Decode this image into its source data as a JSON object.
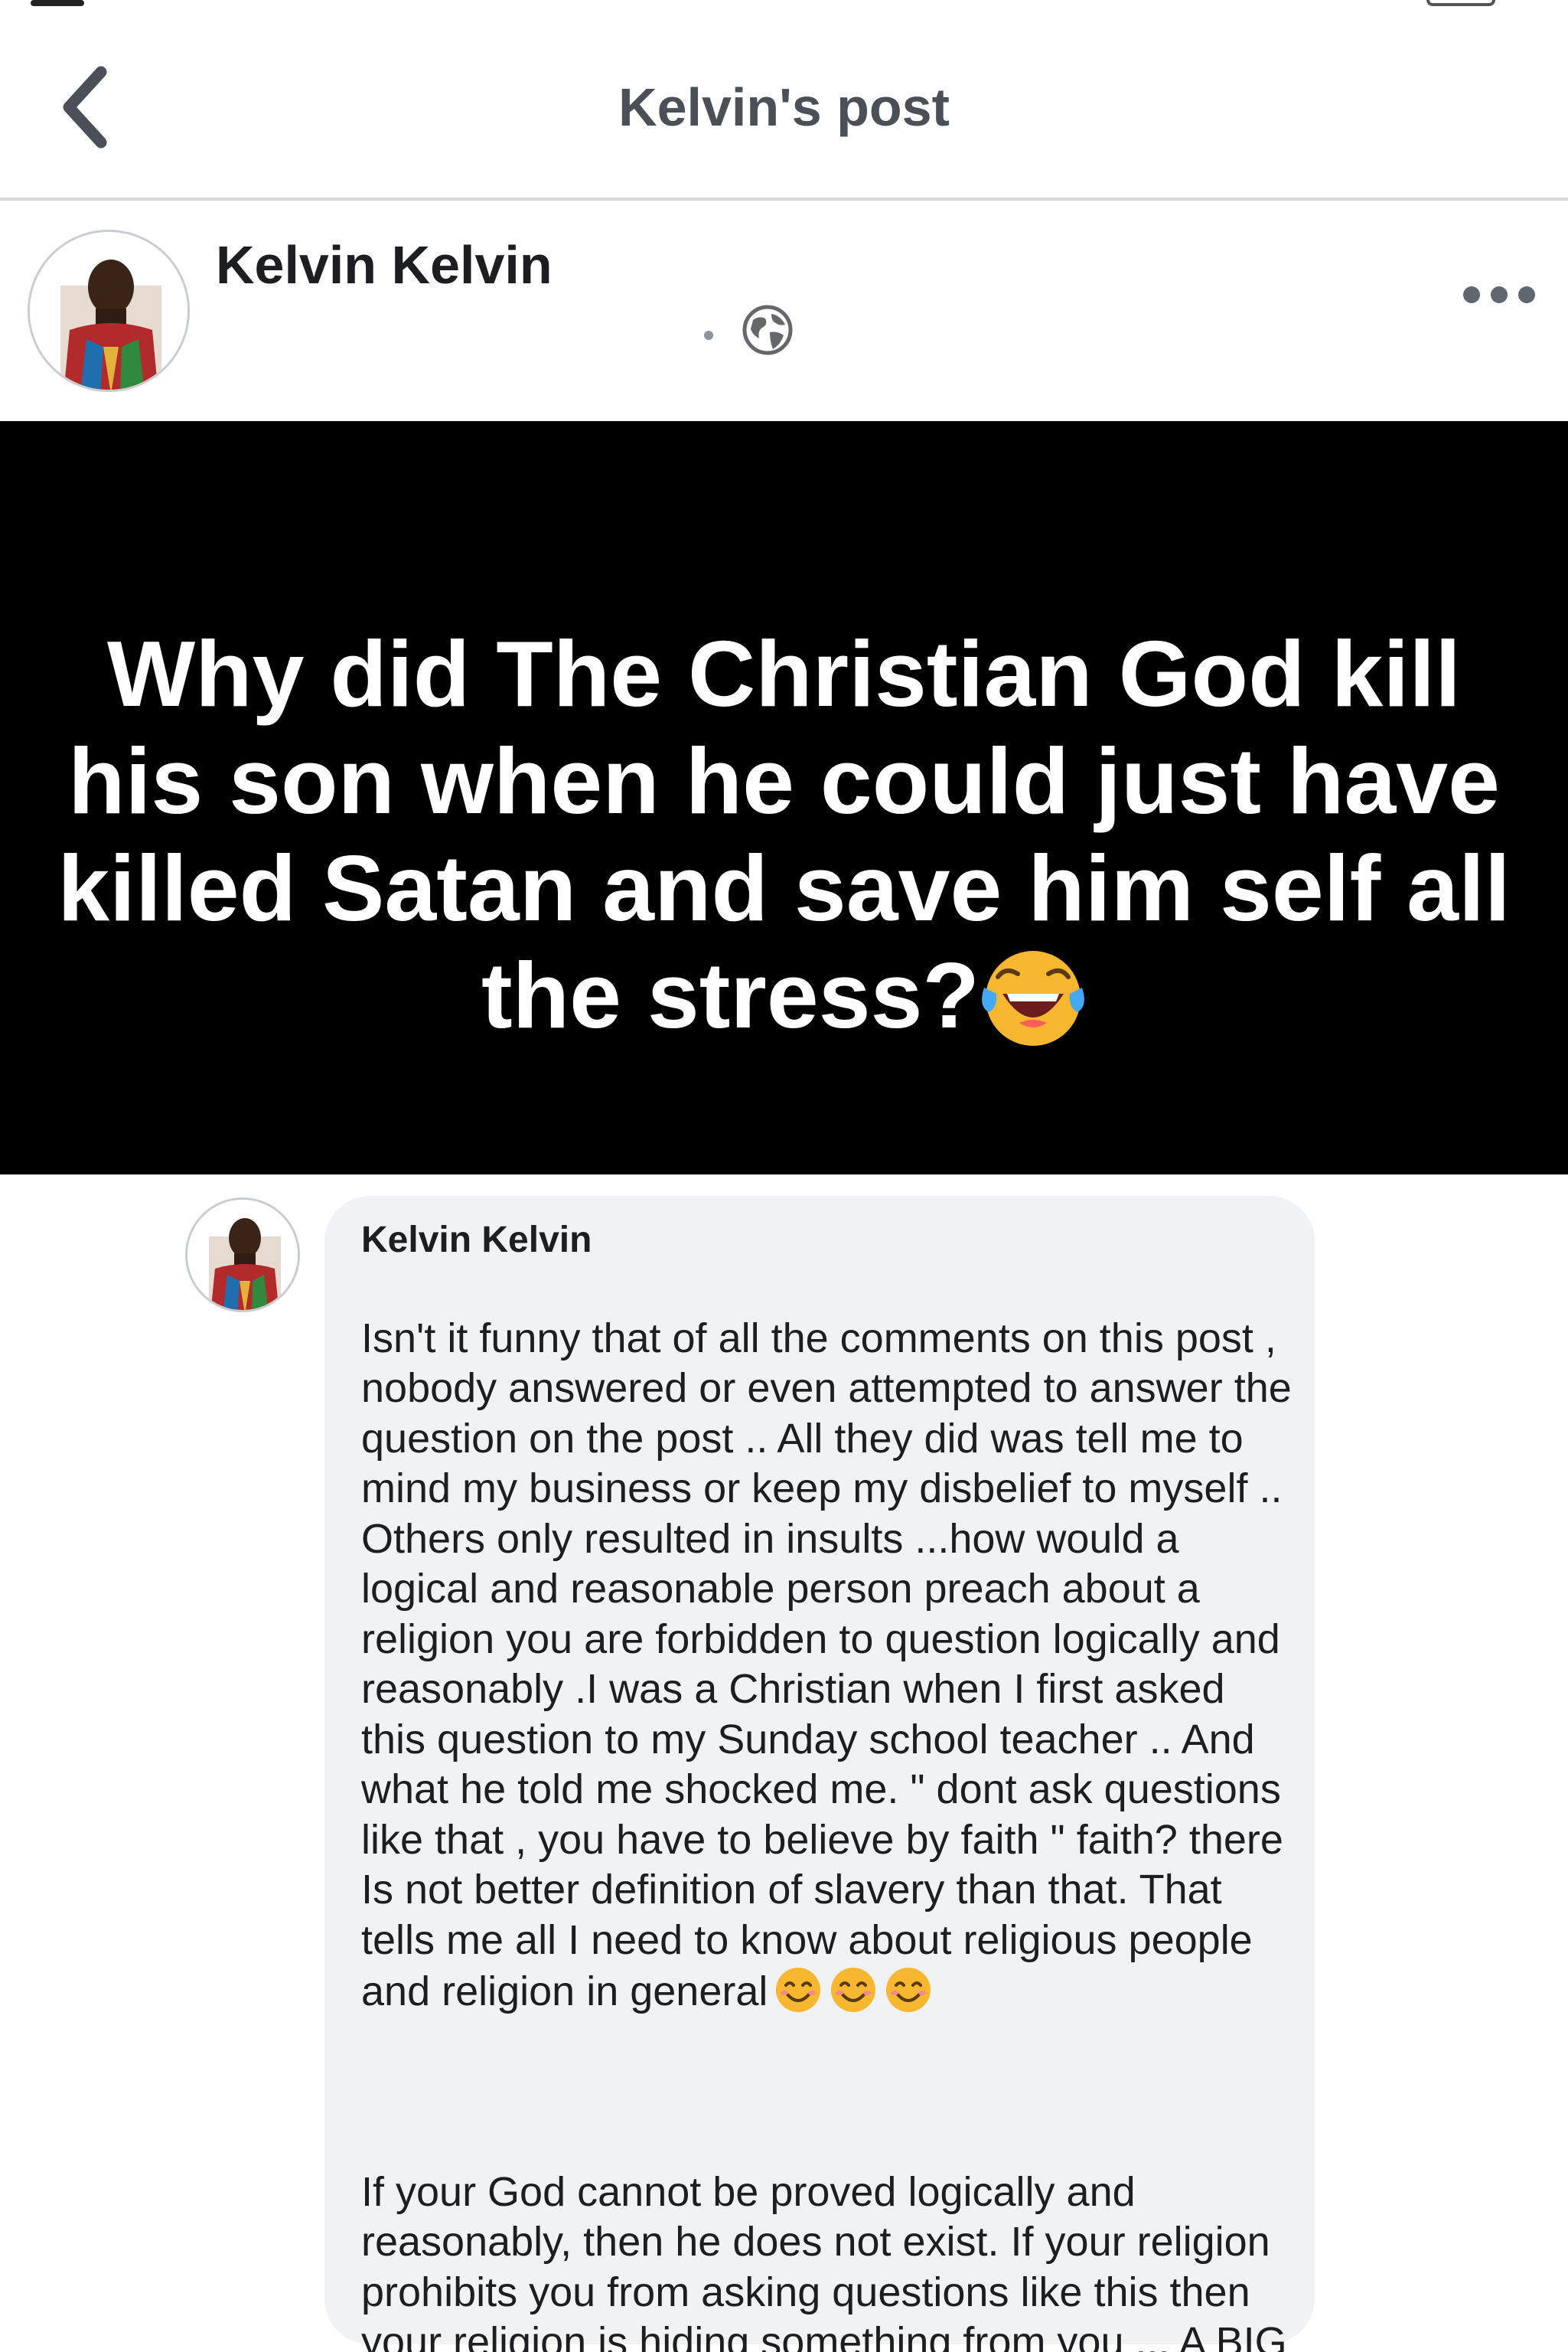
{
  "header": {
    "title": "Kelvin's post",
    "back_icon": "chevron-left-icon"
  },
  "post": {
    "author": "Kelvin Kelvin",
    "separator": "·",
    "privacy_icon": "globe-icon",
    "more_icon": "more-dots-icon",
    "image_text": "Why did The Christian  God kill his son when he could just have killed Satan and save him self all the stress?",
    "image_emoji": "face-with-tears-of-joy-emoji",
    "image_background": "#000000"
  },
  "comment": {
    "author": "Kelvin Kelvin",
    "paragraph_1": "Isn't it funny that of all the comments on this post , nobody answered or even attempted to answer the question on the post .. All they did was tell me to mind my business or keep my disbelief to myself .. Others only resulted in insults ...how would a logical and reasonable person preach about a religion you are forbidden to question logically and reasonably .I was a Christian when I first asked this question to my Sunday school teacher .. And what he told me shocked me. \" dont ask questions like that , you have to believe by faith \" faith?  there Is not better definition of slavery than that.  That tells me all I need to know about religious people and religion in general",
    "paragraph_1_emoji": "smiling-face-emoji",
    "paragraph_2": "If your God cannot be proved logically and reasonably, then he does not exist. If your religion prohibits you from asking questions like this then your religion is hiding something from you ... A BIG FAT LIE.",
    "bubble_color": "#f0f2f5"
  }
}
